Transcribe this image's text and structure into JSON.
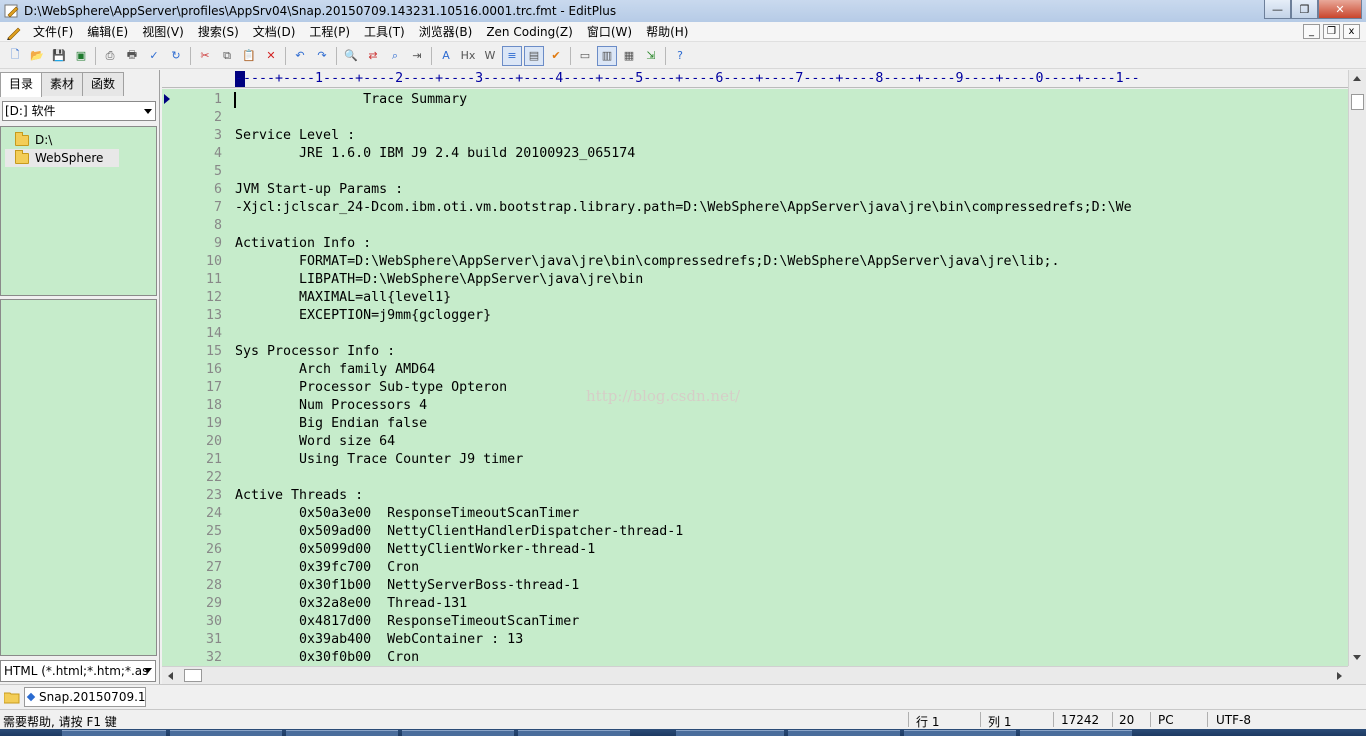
{
  "window": {
    "title": "D:\\WebSphere\\AppServer\\profiles\\AppSrv04\\Snap.20150709.143231.10516.0001.trc.fmt - EditPlus",
    "minimize_glyph": "—",
    "maximize_glyph": "❐",
    "close_glyph": "✕"
  },
  "menu": {
    "items": [
      "文件(F)",
      "编辑(E)",
      "视图(V)",
      "搜索(S)",
      "文档(D)",
      "工程(P)",
      "工具(T)",
      "浏览器(B)",
      "Zen Coding(Z)",
      "窗口(W)",
      "帮助(H)"
    ],
    "mdi_minimize": "_",
    "mdi_restore": "❐",
    "mdi_close": "x"
  },
  "toolbar": {
    "buttons": [
      {
        "name": "new-file",
        "glyph": "🗋",
        "color": "#2d6bd1"
      },
      {
        "name": "open-file",
        "glyph": "📂",
        "color": "#d9a520"
      },
      {
        "name": "save",
        "glyph": "💾",
        "color": "#1e7a2e"
      },
      {
        "name": "save-all",
        "glyph": "▣",
        "color": "#1e7a2e"
      },
      {
        "sep": true
      },
      {
        "name": "print-preview",
        "glyph": "⎙",
        "color": "#555555"
      },
      {
        "name": "print",
        "glyph": "🖶",
        "color": "#555555"
      },
      {
        "name": "spell-check",
        "glyph": "✓",
        "color": "#2d6bd1"
      },
      {
        "name": "refresh",
        "glyph": "↻",
        "color": "#2d6bd1"
      },
      {
        "sep": true
      },
      {
        "name": "cut",
        "glyph": "✂",
        "color": "#cc3333"
      },
      {
        "name": "copy",
        "glyph": "⧉",
        "color": "#555555"
      },
      {
        "name": "paste",
        "glyph": "📋",
        "color": "#a0702a"
      },
      {
        "name": "delete",
        "glyph": "✕",
        "color": "#d22222"
      },
      {
        "sep": true
      },
      {
        "name": "undo",
        "glyph": "↶",
        "color": "#2d6bd1"
      },
      {
        "name": "redo",
        "glyph": "↷",
        "color": "#2d6bd1"
      },
      {
        "sep": true
      },
      {
        "name": "find",
        "glyph": "🔍",
        "color": "#2d6bd1"
      },
      {
        "name": "replace",
        "glyph": "⇄",
        "color": "#cc3333"
      },
      {
        "name": "find-in-files",
        "glyph": "⌕",
        "color": "#2d6bd1"
      },
      {
        "name": "goto-line",
        "glyph": "⇥",
        "color": "#555555"
      },
      {
        "sep": true
      },
      {
        "name": "font",
        "glyph": "A",
        "color": "#2d6bd1"
      },
      {
        "name": "hex",
        "glyph": "Hx",
        "color": "#555555"
      },
      {
        "name": "word-wrap",
        "glyph": "W",
        "color": "#555555"
      },
      {
        "name": "line-numbers",
        "glyph": "≡",
        "color": "#2d6bd1",
        "active": true
      },
      {
        "name": "ruler",
        "glyph": "▤",
        "color": "#555555",
        "active": true
      },
      {
        "name": "check",
        "glyph": "✔",
        "color": "#e07a10"
      },
      {
        "sep": true
      },
      {
        "name": "browser",
        "glyph": "▭",
        "color": "#555555"
      },
      {
        "name": "directory-window",
        "glyph": "▥",
        "color": "#555555",
        "active": true
      },
      {
        "name": "output-window",
        "glyph": "▦",
        "color": "#555555"
      },
      {
        "name": "run",
        "glyph": "⇲",
        "color": "#2d8a2d"
      },
      {
        "sep": true
      },
      {
        "name": "help",
        "glyph": "?",
        "color": "#2d6bd1"
      }
    ]
  },
  "sidebar": {
    "tabs": [
      "目录",
      "素材",
      "函数"
    ],
    "drive": "[D:] 软件",
    "tree": [
      {
        "label": "D:\\",
        "selected": false
      },
      {
        "label": "WebSphere",
        "selected": true
      }
    ],
    "filter": "HTML (*.html;*.htm;*.as"
  },
  "editor": {
    "ruler": "-----+----1----+----2----+----3----+----4----+----5----+----6----+----7----+----8----+----9----+----0----+----1--",
    "watermark": "http://blog.csdn.net/",
    "lines": [
      {
        "n": "1",
        "text": "                Trace Summary"
      },
      {
        "n": "2",
        "text": ""
      },
      {
        "n": "3",
        "text": "Service Level :"
      },
      {
        "n": "4",
        "text": "        JRE 1.6.0 IBM J9 2.4 build 20100923_065174"
      },
      {
        "n": "5",
        "text": ""
      },
      {
        "n": "6",
        "text": "JVM Start-up Params :"
      },
      {
        "n": "7",
        "text": "-Xjcl:jclscar_24-Dcom.ibm.oti.vm.bootstrap.library.path=D:\\WebSphere\\AppServer\\java\\jre\\bin\\compressedrefs;D:\\We"
      },
      {
        "n": "8",
        "text": ""
      },
      {
        "n": "9",
        "text": "Activation Info :"
      },
      {
        "n": "10",
        "text": "        FORMAT=D:\\WebSphere\\AppServer\\java\\jre\\bin\\compressedrefs;D:\\WebSphere\\AppServer\\java\\jre\\lib;."
      },
      {
        "n": "11",
        "text": "        LIBPATH=D:\\WebSphere\\AppServer\\java\\jre\\bin"
      },
      {
        "n": "12",
        "text": "        MAXIMAL=all{level1}"
      },
      {
        "n": "13",
        "text": "        EXCEPTION=j9mm{gclogger}"
      },
      {
        "n": "14",
        "text": ""
      },
      {
        "n": "15",
        "text": "Sys Processor Info :"
      },
      {
        "n": "16",
        "text": "        Arch family AMD64"
      },
      {
        "n": "17",
        "text": "        Processor Sub-type Opteron"
      },
      {
        "n": "18",
        "text": "        Num Processors 4"
      },
      {
        "n": "19",
        "text": "        Big Endian false"
      },
      {
        "n": "20",
        "text": "        Word size 64"
      },
      {
        "n": "21",
        "text": "        Using Trace Counter J9 timer"
      },
      {
        "n": "22",
        "text": ""
      },
      {
        "n": "23",
        "text": "Active Threads :"
      },
      {
        "n": "24",
        "text": "        0x50a3e00  ResponseTimeoutScanTimer"
      },
      {
        "n": "25",
        "text": "        0x509ad00  NettyClientHandlerDispatcher-thread-1"
      },
      {
        "n": "26",
        "text": "        0x5099d00  NettyClientWorker-thread-1"
      },
      {
        "n": "27",
        "text": "        0x39fc700  Cron"
      },
      {
        "n": "28",
        "text": "        0x30f1b00  NettyServerBoss-thread-1"
      },
      {
        "n": "29",
        "text": "        0x32a8e00  Thread-131"
      },
      {
        "n": "30",
        "text": "        0x4817d00  ResponseTimeoutScanTimer"
      },
      {
        "n": "31",
        "text": "        0x39ab400  WebContainer : 13"
      },
      {
        "n": "32",
        "text": "        0x30f0b00  Cron"
      }
    ]
  },
  "doc_tabs": [
    {
      "label": "Snap.20150709.1",
      "active": true
    }
  ],
  "status": {
    "help": "需要帮助, 请按 F1 键",
    "line": "行 1",
    "col": "列 1",
    "size": "17242",
    "lines_count": "20",
    "eol": "PC",
    "encoding": "UTF-8"
  },
  "colors": {
    "editor_bg": "#c6eccb",
    "line_number": "#888888",
    "ruler_text": "#0000a0"
  }
}
